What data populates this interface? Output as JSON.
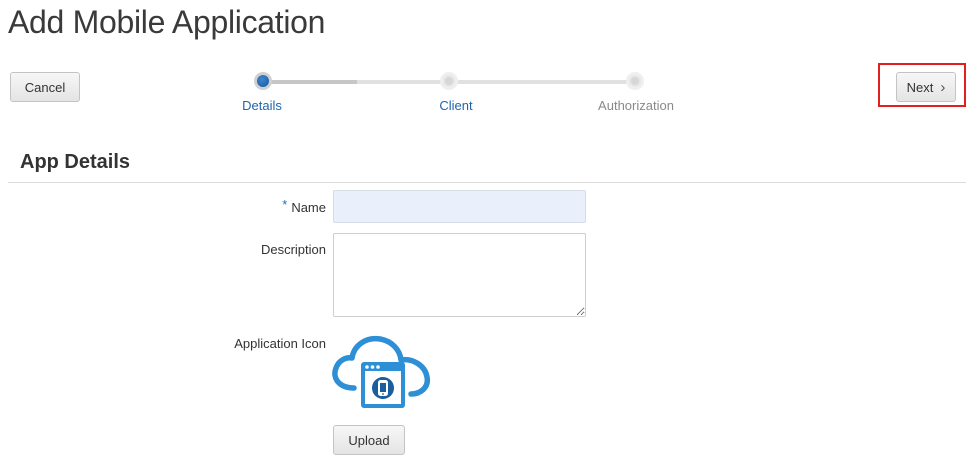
{
  "header": {
    "title": "Add Mobile Application"
  },
  "toolbar": {
    "cancel_label": "Cancel",
    "next_label": "Next",
    "next_icon": "chevron-right-icon"
  },
  "train": {
    "current_step": 0,
    "steps": [
      {
        "label": "Details",
        "state": "current"
      },
      {
        "label": "Client",
        "state": "pending"
      },
      {
        "label": "Authorization",
        "state": "pending"
      }
    ]
  },
  "section": {
    "title": "App Details"
  },
  "form": {
    "required_marker": "*",
    "name_label": "Name",
    "name_value": "",
    "description_label": "Description",
    "description_value": "",
    "icon_label": "Application Icon",
    "icon_name": "cloud-mobile-app-icon",
    "upload_label": "Upload"
  },
  "colors": {
    "accent": "#1f65ad",
    "highlight_border": "#e0201f",
    "icon_blue": "#2d8fd5",
    "name_field_bg": "#e9effb"
  }
}
